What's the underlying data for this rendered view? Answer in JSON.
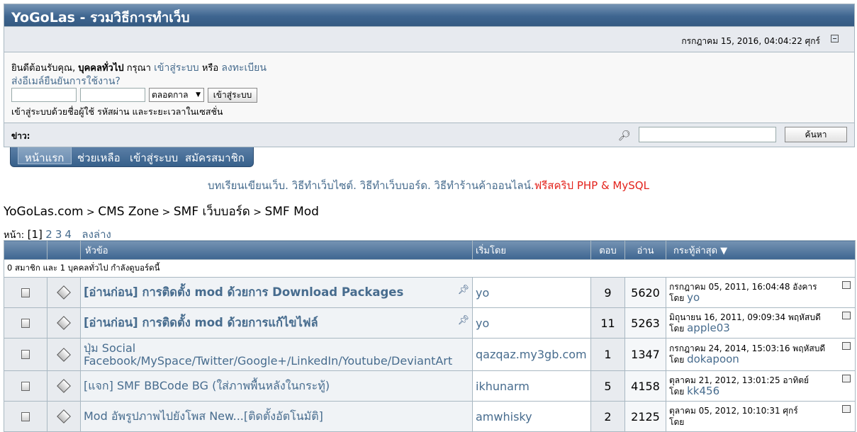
{
  "header": {
    "site_title": "YoGoLas - รวมวิธีการทำเว็บ",
    "datetime": "กรกฎาคม 15, 2016, 04:04:22 ศุกร์"
  },
  "login": {
    "welcome_prefix": "ยินดีต้อนรับคุณ, ",
    "guest": "บุคคลทั่วไป",
    "please": " กรุณา ",
    "login_link": "เข้าสู่ระบบ",
    "or": " หรือ ",
    "register_link": "ลงทะเบียน",
    "resend_link": "ส่งอีเมล์ยืนยันการใช้งาน?",
    "duration_selected": "ตลอดกาล",
    "login_button": "เข้าสู่ระบบ",
    "hint": "เข้าสู่ระบบด้วยชื่อผู้ใช้ รหัสผ่าน และระยะเวลาในเซสชั่น"
  },
  "news": {
    "label": "ข่าว:",
    "search_button": "ค้นหา"
  },
  "menu": {
    "items": [
      "หน้าแรก",
      "ช่วยเหลือ",
      "เข้าสู่ระบบ",
      "สมัครสมาชิก"
    ]
  },
  "slogan": {
    "text": "บทเรียนเขียนเว็บ. วิธีทำเว็บไซต์. วิธีทำเว็บบอร์ด. วิธีทำร้านค้าออนไลน์.",
    "red": "ฟรีสคริป PHP & MySQL"
  },
  "breadcrumb": {
    "items": [
      "YoGoLas.com",
      "CMS Zone",
      "SMF เว็บบอร์ด",
      "SMF Mod"
    ],
    "sep": " > "
  },
  "pagination": {
    "label": "หน้า:",
    "current": "[1]",
    "pages": [
      "2",
      "3",
      "4"
    ],
    "down": "ลงล่าง"
  },
  "table": {
    "headers": {
      "subject": "หัวข้อ",
      "started_by": "เริ่มโดย",
      "replies": "ตอบ",
      "views": "อ่าน",
      "last_post": "กระทู้ล่าสุด ▼"
    },
    "presence": "0 สมาชิก และ 1 บุคคลทั่วไป กำลังดูบอร์ดนี้",
    "rows": [
      {
        "subject": "[อ่านก่อน] การติดตั้ง mod ด้วยการ Download Packages",
        "starter": "yo",
        "replies": "9",
        "views": "5620",
        "last_date": "กรกฎาคม 05, 2011, 16:04:48 อังคาร",
        "by": "โดย",
        "last_user": "yo"
      },
      {
        "subject": "[อ่านก่อน] การติดตั้ง mod ด้วยการแก้ไขไฟล์",
        "starter": "yo",
        "replies": "11",
        "views": "5263",
        "last_date": "มิถุนายน 16, 2011, 09:09:34 พฤหัสบดี",
        "by": "โดย",
        "last_user": "apple03"
      },
      {
        "subject": "ปุ่ม Social Facebook/MySpace/Twitter/Google+/LinkedIn/Youtube/DeviantArt",
        "starter": "qazqaz.my3gb.com",
        "replies": "1",
        "views": "1347",
        "last_date": "กรกฎาคม 24, 2014, 15:03:16 พฤหัสบดี",
        "by": "โดย",
        "last_user": "dokapoon"
      },
      {
        "subject": "[แจก] SMF BBCode BG (ใส่ภาพพื้นหลังในกระทู้)",
        "starter": "ikhunarm",
        "replies": "5",
        "views": "4158",
        "last_date": "ตุลาคม 21, 2012, 13:01:25 อาทิตย์",
        "by": "โดย",
        "last_user": "kk456"
      },
      {
        "subject": "Mod อัพรูปภาพไปยังโพส New...[ติดตั้งอัตโนมัติ]",
        "starter": "amwhisky",
        "replies": "2",
        "views": "2125",
        "last_date": "ตุลาคม 05, 2012, 10:10:31 ศุกร์",
        "by": "โดย",
        "last_user": ""
      }
    ]
  }
}
